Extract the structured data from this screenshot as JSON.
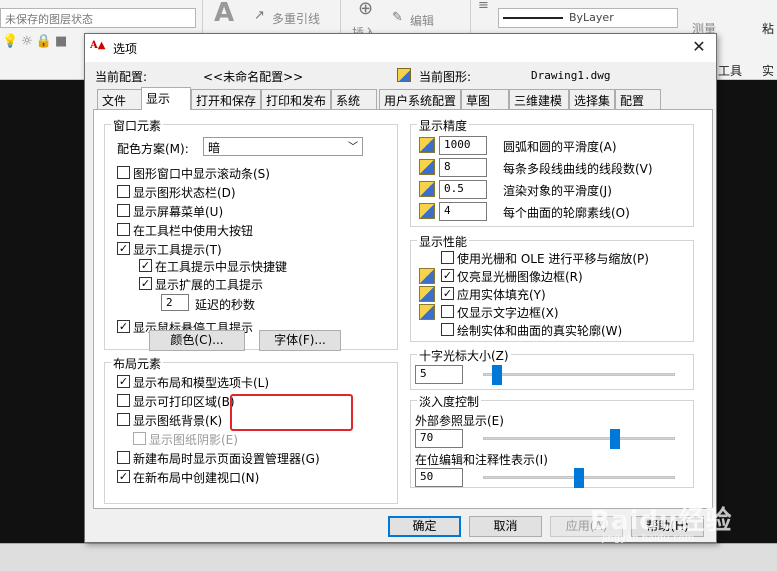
{
  "app": {
    "layer_state": "未保存的图层状态",
    "multileader": "多重引线",
    "insert": "插入",
    "edit": "编辑",
    "bylayer": "ByLayer",
    "measure": "测量",
    "tools_menu": "工具",
    "right_cut": "粘",
    "right_edge": "实"
  },
  "dialog": {
    "title": "选项",
    "close_glyph": "✕",
    "current_profile_label": "当前配置:",
    "current_profile_value": "<<未命名配置>>",
    "current_drawing_label": "当前图形:",
    "current_drawing_value": "Drawing1.dwg",
    "tabs": [
      {
        "label": "文件"
      },
      {
        "label": "显示"
      },
      {
        "label": "打开和保存"
      },
      {
        "label": "打印和发布"
      },
      {
        "label": "系统"
      },
      {
        "label": "用户系统配置"
      },
      {
        "label": "草图"
      },
      {
        "label": "三维建模"
      },
      {
        "label": "选择集"
      },
      {
        "label": "配置"
      }
    ],
    "active_tab": "显示"
  },
  "window_elements": {
    "title": "窗口元素",
    "color_scheme_label": "配色方案(M):",
    "color_scheme_value": "暗",
    "scrollbars": {
      "label": "图形窗口中显示滚动条(S)",
      "checked": false
    },
    "status_bar": {
      "label": "显示图形状态栏(D)",
      "checked": false
    },
    "screen_menu": {
      "label": "显示屏幕菜单(U)",
      "checked": false
    },
    "large_buttons": {
      "label": "在工具栏中使用大按钮",
      "checked": false
    },
    "tooltips": {
      "label": "显示工具提示(T)",
      "checked": true
    },
    "shortcut_keys": {
      "label": "在工具提示中显示快捷键",
      "checked": true
    },
    "extended_tooltips": {
      "label": "显示扩展的工具提示",
      "checked": true
    },
    "delay_value": "2",
    "delay_label": "延迟的秒数",
    "rollover_tooltips": {
      "label": "显示鼠标悬停工具提示",
      "checked": true
    },
    "colors_button": "颜色(C)...",
    "fonts_button": "字体(F)..."
  },
  "layout_elements": {
    "title": "布局元素",
    "layout_tabs": {
      "label": "显示布局和模型选项卡(L)",
      "checked": true
    },
    "printable_area": {
      "label": "显示可打印区域(B)",
      "checked": false
    },
    "paper_background": {
      "label": "显示图纸背景(K)",
      "checked": false
    },
    "paper_shadow": {
      "label": "显示图纸阴影(E)",
      "checked": false
    },
    "page_setup_manager": {
      "label": "新建布局时显示页面设置管理器(G)",
      "checked": false
    },
    "create_viewport": {
      "label": "在新布局中创建视口(N)",
      "checked": true
    }
  },
  "display_resolution": {
    "title": "显示精度",
    "arc_smoothness": {
      "value": "1000",
      "label": "圆弧和圆的平滑度(A)"
    },
    "polyline_segments": {
      "value": "8",
      "label": "每条多段线曲线的线段数(V)"
    },
    "rendered_smoothness": {
      "value": "0.5",
      "label": "渲染对象的平滑度(J)"
    },
    "contour_lines": {
      "value": "4",
      "label": "每个曲面的轮廓素线(O)"
    }
  },
  "display_performance": {
    "title": "显示性能",
    "pan_zoom_raster": {
      "label": "使用光栅和 OLE 进行平移与缩放(P)",
      "checked": false
    },
    "highlight_raster_frame": {
      "label": "仅亮显光栅图像边框(R)",
      "checked": true
    },
    "true_fill": {
      "label": "应用实体填充(Y)",
      "checked": true
    },
    "text_frame": {
      "label": "仅显示文字边框(X)",
      "checked": false
    },
    "silhouettes": {
      "label": "绘制实体和曲面的真实轮廓(W)",
      "checked": false
    }
  },
  "crosshair": {
    "title": "十字光标大小(Z)",
    "value": "5",
    "level": 0.05
  },
  "fade_control": {
    "title": "淡入度控制",
    "xref_label": "外部参照显示(E)",
    "xref_value": "70",
    "xref_level": 0.7,
    "inplace_label": "在位编辑和注释性表示(I)",
    "inplace_value": "50",
    "inplace_level": 0.5
  },
  "buttons": {
    "ok": "确定",
    "cancel": "取消",
    "apply": "应用(A)",
    "help": "帮助(H)"
  },
  "watermark": {
    "brand": "Baidu经验",
    "url": "jingyan.baidu.com"
  }
}
